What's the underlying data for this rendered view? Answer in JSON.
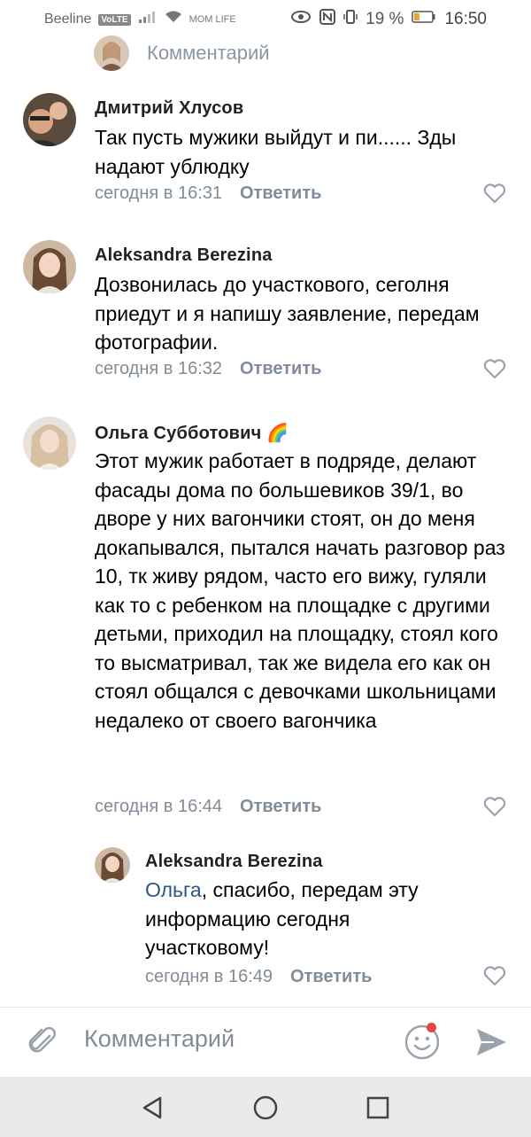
{
  "status_bar": {
    "carrier": "Beeline",
    "volte": "VoLTE",
    "mini_label": "MOM LIFE",
    "battery": "19 %",
    "time": "16:50"
  },
  "top_partial": {
    "label": "Комментарий"
  },
  "comments": [
    {
      "author": "Дмитрий Хлусов",
      "text": "Так пусть мужики выйдут и пи...... Зды надают ублюдку",
      "time": "сегодня в 16:31",
      "reply_label": "Ответить"
    },
    {
      "author": "Aleksandra Berezina",
      "text": "Дозвонилась до участкового, сеголня приедут и я напишу заявление, передам фотографии.",
      "time": "сегодня в 16:32",
      "reply_label": "Ответить"
    },
    {
      "author": "Ольга Субботович 🌈",
      "text": "Этот мужик работает в подряде, делают фасады дома по большевиков 39/1, во дворе у них вагончики стоят, он до меня докапывался, пытался начать разговор раз 10, тк живу рядом, часто его вижу, гуляли как то с ребенком на площадке с другими детьми, приходил на площадку, стоял кого то высматривал, так же видела его как он стоял общался с девочками школьницами недалеко от своего вагончика",
      "time": "сегодня в 16:44",
      "reply_label": "Ответить"
    }
  ],
  "reply": {
    "author": "Aleksandra Berezina",
    "mention": "Ольга",
    "text": ", спасибо, передам эту информацию сегодня участковому!",
    "time": "сегодня в 16:49",
    "reply_label": "Ответить"
  },
  "input": {
    "placeholder": "Комментарий"
  },
  "icons": {
    "attach": "paperclip-icon",
    "emoji": "smiley-icon",
    "send": "send-icon",
    "like": "heart-icon",
    "back": "back-triangle-icon",
    "home": "home-circle-icon",
    "recents": "recents-square-icon"
  },
  "colors": {
    "link": "#2a5885",
    "meta": "#818c99",
    "icon": "#99a2ad",
    "notification_dot": "#e64646"
  }
}
